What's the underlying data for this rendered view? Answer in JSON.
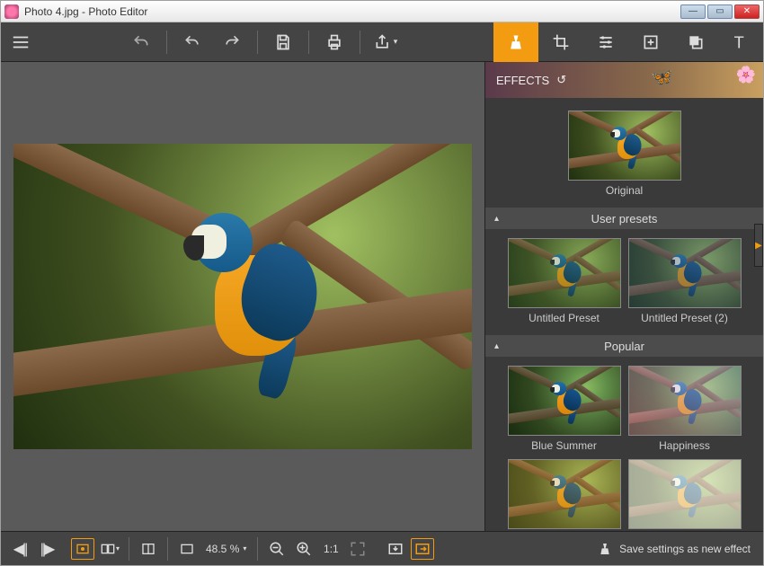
{
  "window": {
    "title": "Photo 4.jpg - Photo Editor"
  },
  "toolbar": {
    "menu": "menu",
    "undo_redo_group1": "undo",
    "undo2": "undo-arrow",
    "redo2": "redo-arrow",
    "save": "save",
    "print": "print",
    "share": "share"
  },
  "tabs": {
    "effects": "effects",
    "crop": "crop",
    "adjust": "adjust",
    "batch": "batch",
    "layers": "layers",
    "text": "text",
    "active": "effects"
  },
  "effects_panel": {
    "header": "EFFECTS",
    "original_label": "Original",
    "sections": [
      {
        "title": "User presets",
        "items": [
          {
            "label": "Untitled Preset",
            "overlay": "overlay-userpreset"
          },
          {
            "label": "Untitled Preset (2)",
            "overlay": "overlay-userpreset2"
          }
        ]
      },
      {
        "title": "Popular",
        "items": [
          {
            "label": "Blue Summer",
            "overlay": "overlay-bluesummer"
          },
          {
            "label": "Happiness",
            "overlay": "overlay-happiness"
          },
          {
            "label": "",
            "overlay": "overlay-warm"
          },
          {
            "label": "",
            "overlay": "overlay-lowkey"
          }
        ]
      }
    ]
  },
  "bottombar": {
    "zoom_value": "48.5 %",
    "save_effect": "Save settings as new effect"
  }
}
